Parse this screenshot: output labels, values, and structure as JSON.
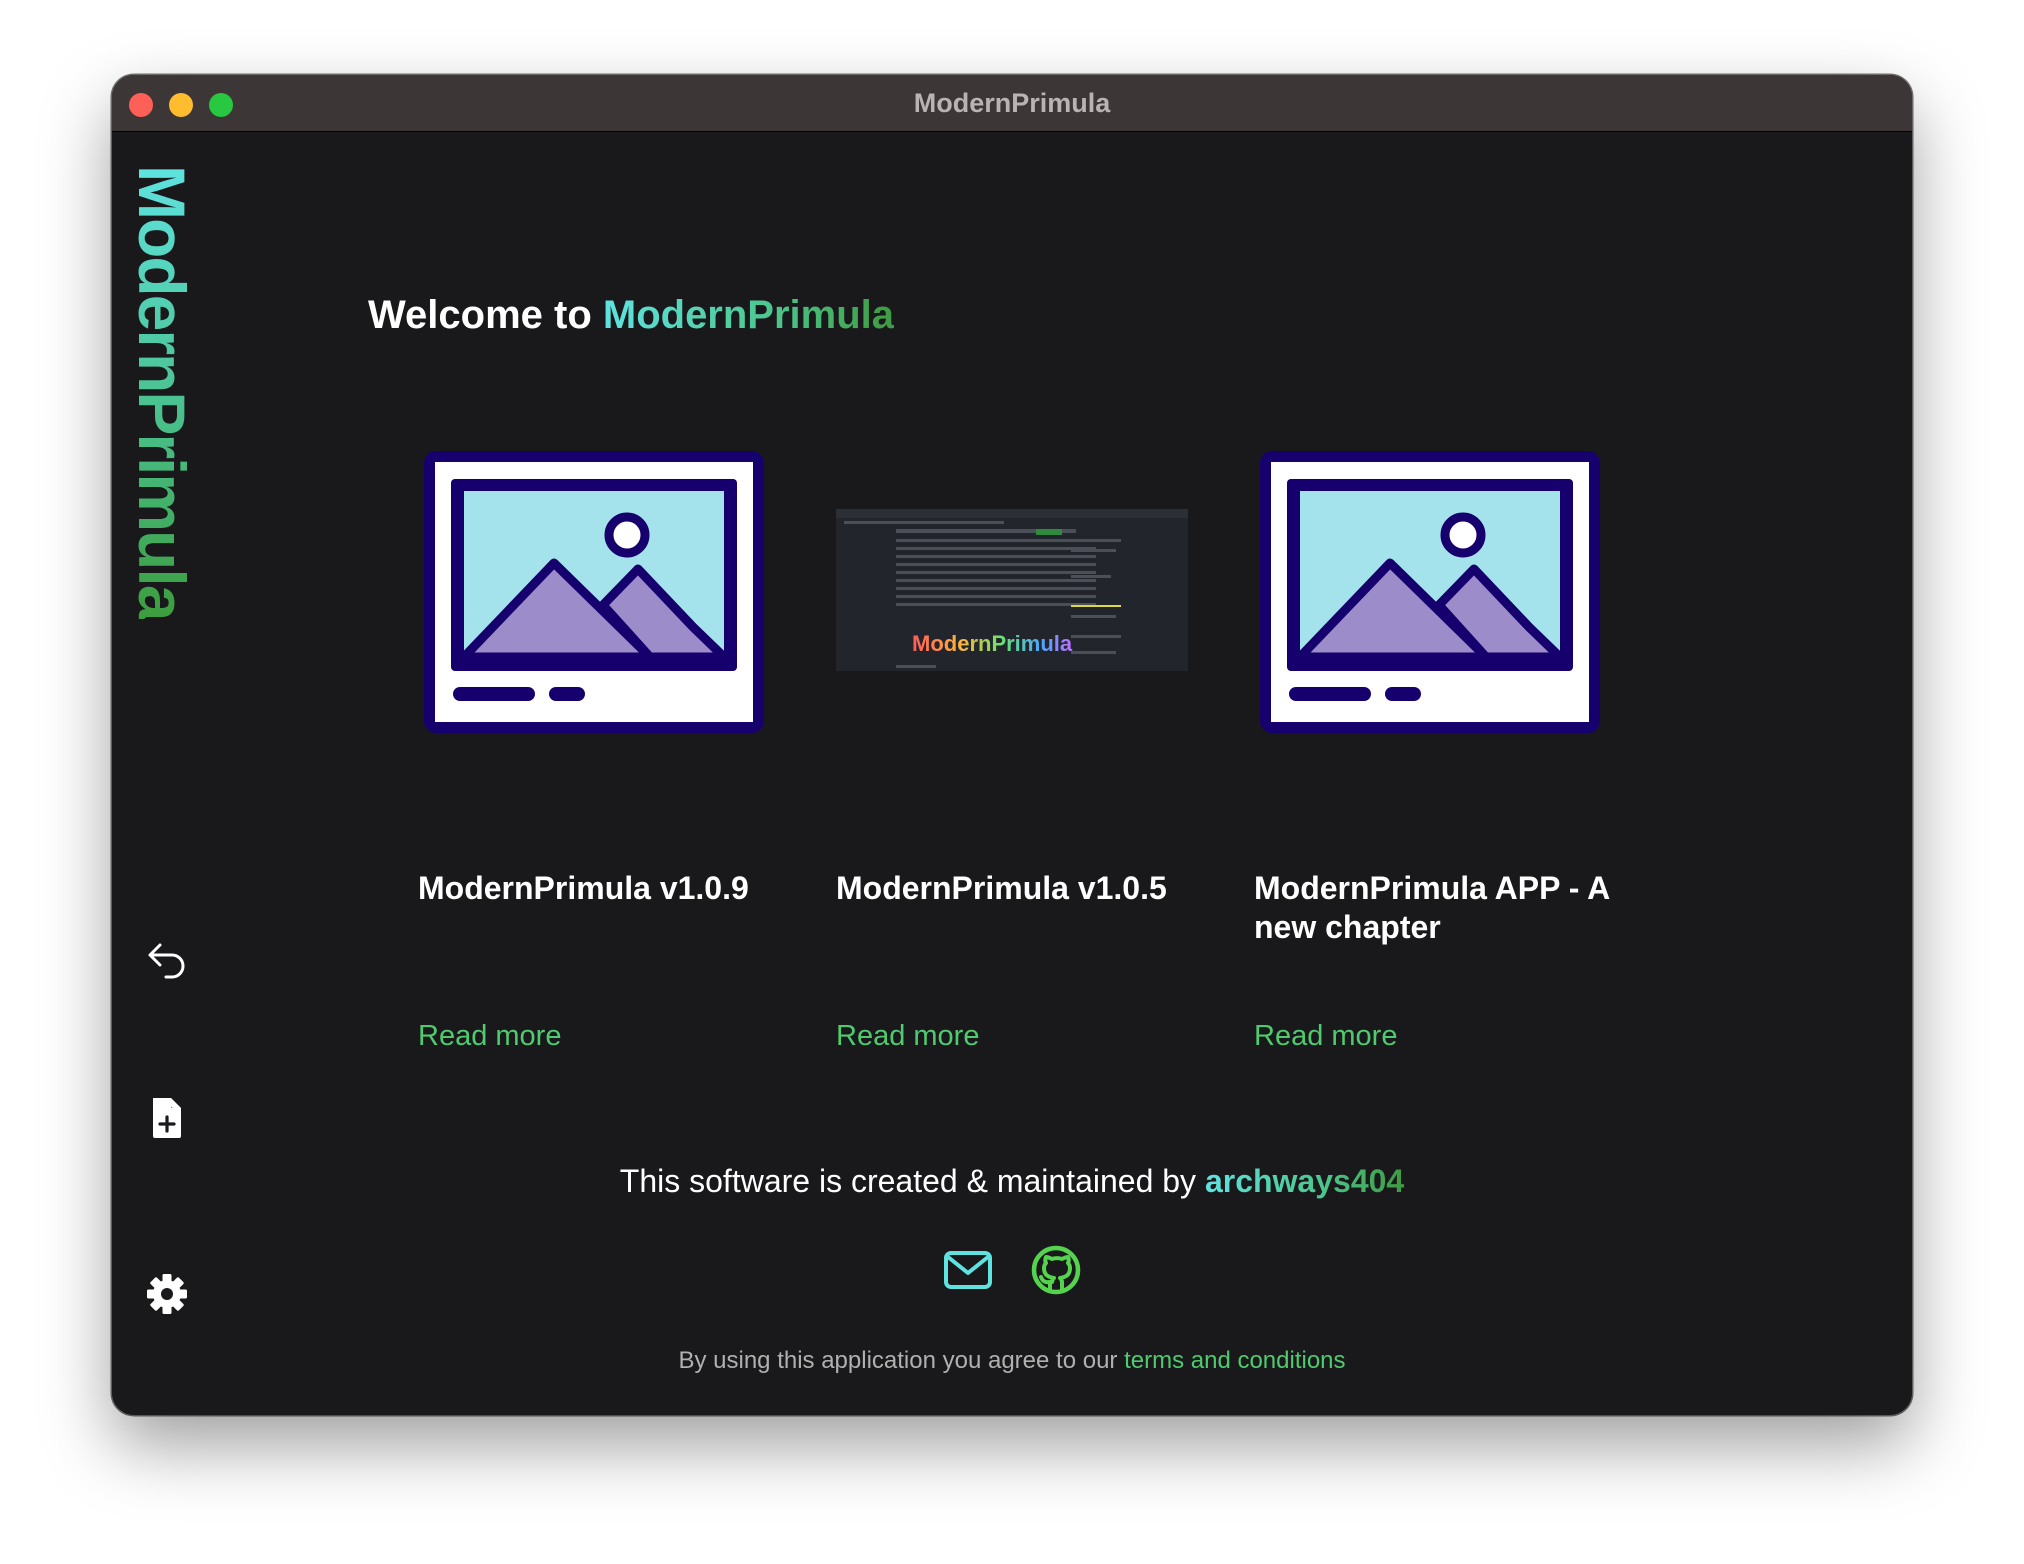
{
  "window": {
    "title": "ModernPrimula"
  },
  "sidebar": {
    "logo_text": "ModernPrimula",
    "icons": [
      "undo-icon",
      "new-file-icon",
      "gear-icon"
    ]
  },
  "main": {
    "welcome_prefix": "Welcome to ",
    "welcome_app": "ModernPrimula",
    "cards": [
      {
        "title": "ModernPrimula v1.0.9",
        "image": "placeholder-image",
        "link": "Read more"
      },
      {
        "title": "ModernPrimula v1.0.5",
        "image": "app-screenshot-thumbnail",
        "thumbnail_logo": "ModernPrimula",
        "link": "Read more"
      },
      {
        "title": "ModernPrimula APP - A new chapter",
        "image": "placeholder-image",
        "link": "Read more"
      }
    ]
  },
  "footer": {
    "credit_prefix": "This software is created & maintained by ",
    "credit_name": "archways404",
    "icons": [
      "mail-icon",
      "github-icon"
    ],
    "terms_prefix": "By using this application you agree to our ",
    "terms_link": "terms and conditions"
  },
  "colors": {
    "background": "#19191c",
    "titlebar": "#3d3636",
    "accent_green": "#4fca6e",
    "accent_cyan": "#5fe3e0",
    "placeholder_navy": "#16006e",
    "placeholder_sky": "#a5e3ec",
    "placeholder_lilac": "#9c8cc9"
  }
}
